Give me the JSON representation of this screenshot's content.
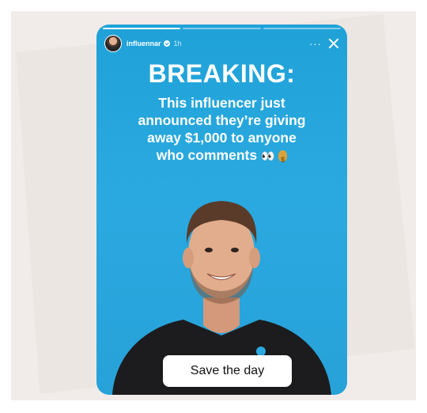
{
  "story": {
    "username": "influennar",
    "time": "1h",
    "more_label": "···",
    "progress_segments": 3,
    "headline": "BREAKING:",
    "body_line1": "This influencer just",
    "body_line2": "announced they’re giving",
    "body_line3": "away $1,000 to anyone",
    "body_line4": "who comments",
    "eyes_emoji": "👀",
    "cta_label": "Save the day",
    "icons": [
      "avatar",
      "verified-badge-icon",
      "more-icon",
      "close-icon",
      "eyes-emoji-icon",
      "money-bag-icon"
    ]
  },
  "colors": {
    "story_background": "#2aa9e0",
    "text": "#ffffff",
    "cta_background": "#ffffff",
    "page_background": "#f1ece9"
  }
}
